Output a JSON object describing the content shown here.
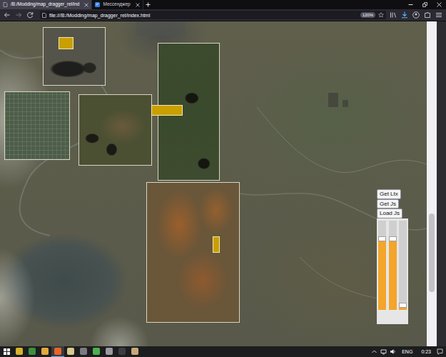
{
  "browser": {
    "tabs": [
      {
        "label": "/B:/Modding/map_dragger_rel/ind",
        "selected": true
      },
      {
        "label": "Мессенджер",
        "selected": false
      }
    ],
    "address": "file:///B:/Modding/map_dragger_rel/index.html",
    "zoom": "120%"
  },
  "page": {
    "buttons": [
      "Get Ltx",
      "Get Js",
      "Load Js"
    ],
    "sliders": [
      {
        "level": 0.82
      },
      {
        "level": 0.82
      },
      {
        "level": 0.08
      }
    ],
    "scroll": {
      "level": 0.78
    }
  },
  "taskbar": {
    "apps": [
      {
        "color": "#d8b22a",
        "selected": false
      },
      {
        "color": "#3d8f3d",
        "selected": false
      },
      {
        "color": "#e3a93a",
        "selected": false
      },
      {
        "color": "#e8642a",
        "selected": true
      },
      {
        "color": "#d9c98a",
        "selected": false
      },
      {
        "color": "#7a7a80",
        "selected": false
      },
      {
        "color": "#4caf50",
        "selected": false
      },
      {
        "color": "#9a9aa0",
        "selected": false
      },
      {
        "color": "#3c3c44",
        "selected": false
      },
      {
        "color": "#c8a878",
        "selected": false
      }
    ],
    "language": "ENG",
    "time": "0:23"
  }
}
